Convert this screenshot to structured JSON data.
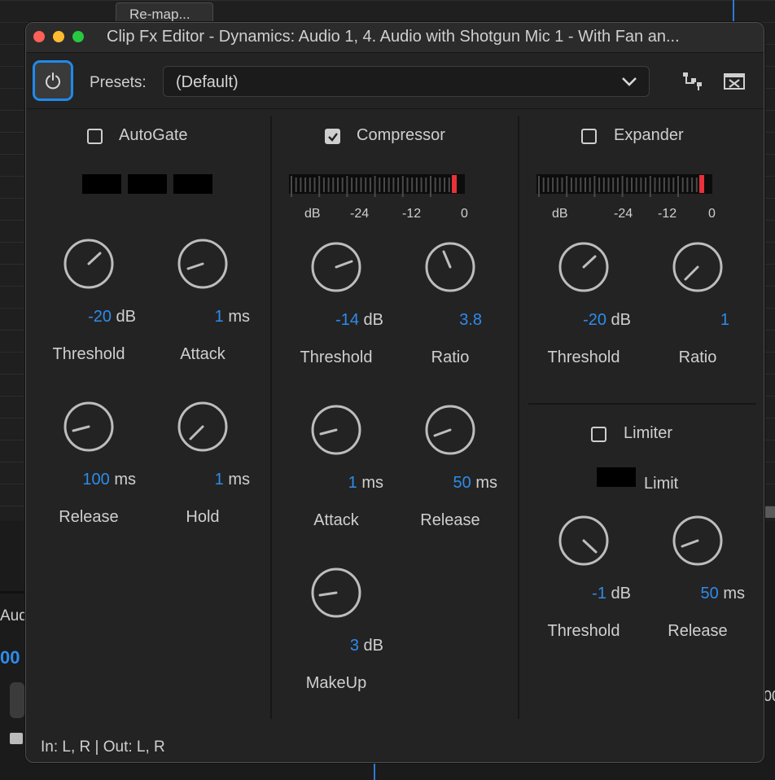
{
  "background": {
    "tab_label": "Re-map...",
    "left_label": "Aud",
    "left_timecode": "00",
    "right_fragment": "00"
  },
  "window": {
    "title": "Clip Fx Editor - Dynamics: Audio 1, 4. Audio with Shotgun Mic 1 - With Fan an..."
  },
  "toolbar": {
    "presets_label": "Presets:",
    "presets_value": "(Default)"
  },
  "autogate": {
    "label": "AutoGate",
    "checked": false,
    "knobs": [
      {
        "value": "-20",
        "unit": "dB",
        "label": "Threshold"
      },
      {
        "value": "1",
        "unit": "ms",
        "label": "Attack"
      },
      {
        "value": "100",
        "unit": "ms",
        "label": "Release"
      },
      {
        "value": "1",
        "unit": "ms",
        "label": "Hold"
      }
    ]
  },
  "compressor": {
    "label": "Compressor",
    "checked": true,
    "meter_labels": [
      "dB",
      "-24",
      "-12",
      "0"
    ],
    "knobs": [
      {
        "value": "-14",
        "unit": "dB",
        "label": "Threshold"
      },
      {
        "value": "3.8",
        "unit": "",
        "label": "Ratio"
      },
      {
        "value": "1",
        "unit": "ms",
        "label": "Attack"
      },
      {
        "value": "50",
        "unit": "ms",
        "label": "Release"
      },
      {
        "value": "3",
        "unit": "dB",
        "label": "MakeUp"
      }
    ]
  },
  "expander": {
    "label": "Expander",
    "checked": false,
    "meter_labels": [
      "dB",
      "-24",
      "-12",
      "0"
    ],
    "knobs": [
      {
        "value": "-20",
        "unit": "dB",
        "label": "Threshold"
      },
      {
        "value": "1",
        "unit": "",
        "label": "Ratio"
      }
    ]
  },
  "limiter": {
    "label": "Limiter",
    "checked": false,
    "limit_label": "Limit",
    "knobs": [
      {
        "value": "-1",
        "unit": "dB",
        "label": "Threshold"
      },
      {
        "value": "50",
        "unit": "ms",
        "label": "Release"
      }
    ]
  },
  "status": {
    "text": "In: L, R | Out: L, R"
  },
  "colors": {
    "accent": "#2d8ceb",
    "panel": "#232323",
    "text": "#cfcfcf",
    "meter_peak": "#e8313a"
  }
}
